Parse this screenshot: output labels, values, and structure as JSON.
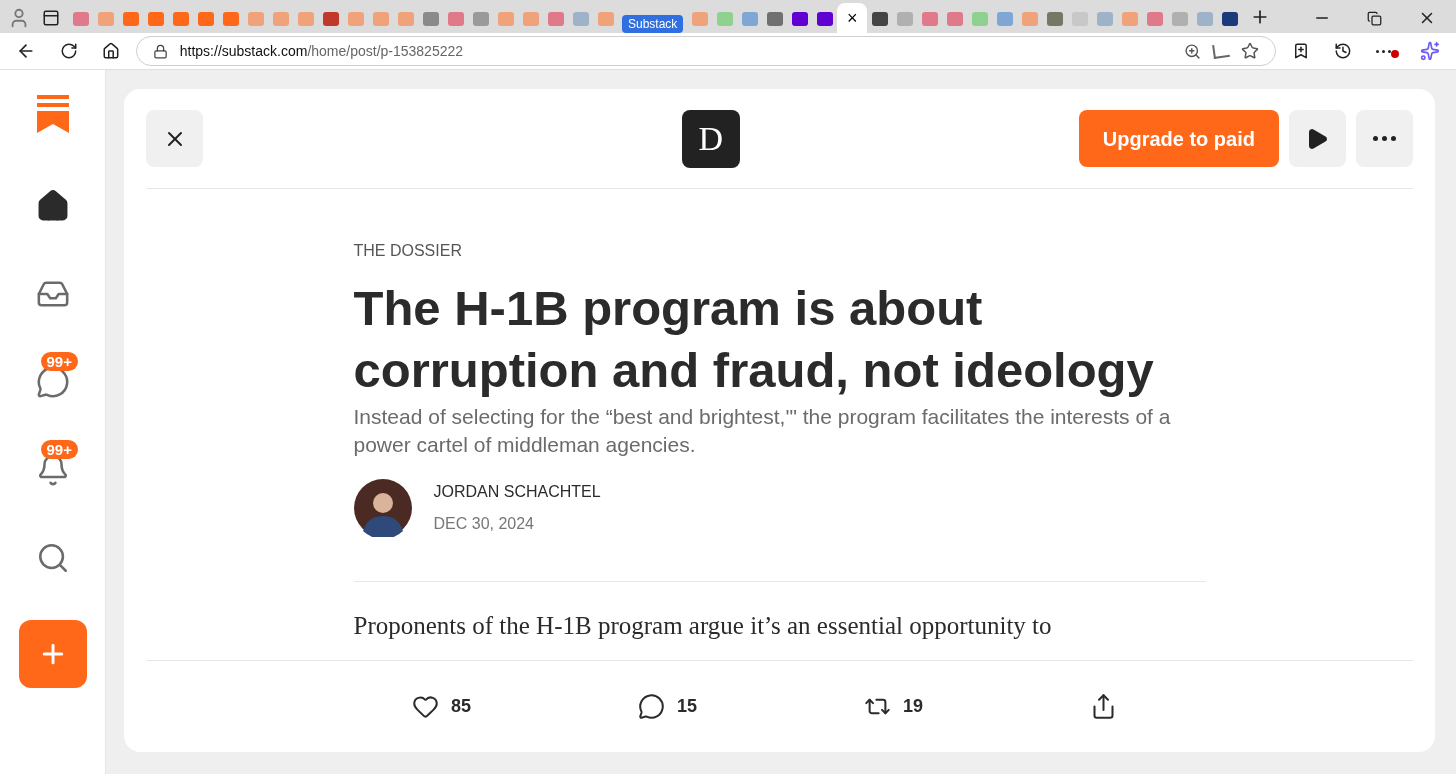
{
  "browser": {
    "tabs": [
      {
        "kind": "favicon",
        "color": "#e07a8a",
        "selected": false
      },
      {
        "kind": "favicon",
        "color": "#f0a27a",
        "selected": false
      },
      {
        "kind": "favicon",
        "color": "#ff6719",
        "selected": false
      },
      {
        "kind": "favicon",
        "color": "#ff6719",
        "selected": false
      },
      {
        "kind": "favicon",
        "color": "#ff6719",
        "selected": false
      },
      {
        "kind": "favicon",
        "color": "#ff6719",
        "selected": false
      },
      {
        "kind": "favicon",
        "color": "#ff6719",
        "selected": false
      },
      {
        "kind": "favicon",
        "color": "#f0a27a",
        "selected": false
      },
      {
        "kind": "favicon",
        "color": "#f0a27a",
        "selected": false
      },
      {
        "kind": "favicon",
        "color": "#f0a27a",
        "selected": false
      },
      {
        "kind": "favicon",
        "color": "#c0392b",
        "selected": false
      },
      {
        "kind": "favicon",
        "color": "#f0a27a",
        "selected": false
      },
      {
        "kind": "favicon",
        "color": "#f0a27a",
        "selected": false
      },
      {
        "kind": "favicon",
        "color": "#f0a27a",
        "selected": false
      },
      {
        "kind": "favicon",
        "color": "#8a8a8a",
        "selected": false
      },
      {
        "kind": "favicon",
        "color": "#e07a8a",
        "selected": false
      },
      {
        "kind": "favicon",
        "color": "#9a9a9a",
        "selected": false
      },
      {
        "kind": "favicon",
        "color": "#f0a27a",
        "selected": false
      },
      {
        "kind": "favicon",
        "color": "#f0a27a",
        "selected": false
      },
      {
        "kind": "favicon",
        "color": "#e07a8a",
        "selected": false
      },
      {
        "kind": "favicon",
        "color": "#9fb3c8",
        "selected": false
      },
      {
        "kind": "favicon",
        "color": "#f0a27a",
        "selected": false
      },
      {
        "kind": "group",
        "label": "Substack",
        "selected": false
      },
      {
        "kind": "favicon",
        "color": "#f0a27a",
        "selected": false
      },
      {
        "kind": "favicon",
        "color": "#8fd18f",
        "selected": false
      },
      {
        "kind": "favicon",
        "color": "#7fa7d6",
        "selected": false
      },
      {
        "kind": "favicon",
        "color": "#707070",
        "selected": false
      },
      {
        "kind": "favicon",
        "color": "#6001d2",
        "selected": false
      },
      {
        "kind": "favicon",
        "color": "#6001d2",
        "selected": false
      },
      {
        "kind": "active",
        "label": "×",
        "selected": true
      },
      {
        "kind": "favicon",
        "color": "#444444",
        "selected": false
      },
      {
        "kind": "favicon",
        "color": "#b0b0b0",
        "selected": false
      },
      {
        "kind": "favicon",
        "color": "#e07a8a",
        "selected": false
      },
      {
        "kind": "favicon",
        "color": "#e07a8a",
        "selected": false
      },
      {
        "kind": "favicon",
        "color": "#8fd18f",
        "selected": false
      },
      {
        "kind": "favicon",
        "color": "#7fa7d6",
        "selected": false
      },
      {
        "kind": "favicon",
        "color": "#f0a27a",
        "selected": false
      },
      {
        "kind": "favicon",
        "color": "#777766",
        "selected": false
      },
      {
        "kind": "favicon",
        "color": "#c8c8c8",
        "selected": false
      },
      {
        "kind": "favicon",
        "color": "#9fb3c8",
        "selected": false
      },
      {
        "kind": "favicon",
        "color": "#f0a27a",
        "selected": false
      },
      {
        "kind": "favicon",
        "color": "#e07a8a",
        "selected": false
      },
      {
        "kind": "favicon",
        "color": "#b0b0b0",
        "selected": false
      },
      {
        "kind": "favicon",
        "color": "#9fb3c8",
        "selected": false
      },
      {
        "kind": "favicon",
        "color": "#1a3a7a",
        "selected": false
      }
    ],
    "url": {
      "host": "https://substack.com",
      "path": "/home/post/p-153825222"
    }
  },
  "sidebar": {
    "items": [
      {
        "kind": "home",
        "selected": true
      },
      {
        "kind": "inbox",
        "selected": false
      },
      {
        "kind": "chat",
        "selected": false,
        "badge": "99+"
      },
      {
        "kind": "activity",
        "selected": false,
        "badge": "99+"
      },
      {
        "kind": "search",
        "selected": false
      }
    ]
  },
  "header": {
    "logo_letter": "D",
    "upgrade_button": "Upgrade to paid"
  },
  "article": {
    "publication": "THE DOSSIER",
    "title": "The H-1B program is about corruption and fraud, not ideology",
    "subtitle": "Instead of selecting for the “best and brightest,'\" the program facilitates the interests of a power cartel of middleman agencies.",
    "author": "JORDAN SCHACHTEL",
    "date": "DEC 30, 2024",
    "body_first_line": "Proponents of the H-1B program argue it’s an essential opportunity to"
  },
  "actions": [
    {
      "kind": "like",
      "count": "85"
    },
    {
      "kind": "comment",
      "count": "15"
    },
    {
      "kind": "restack",
      "count": "19"
    },
    {
      "kind": "share"
    }
  ]
}
